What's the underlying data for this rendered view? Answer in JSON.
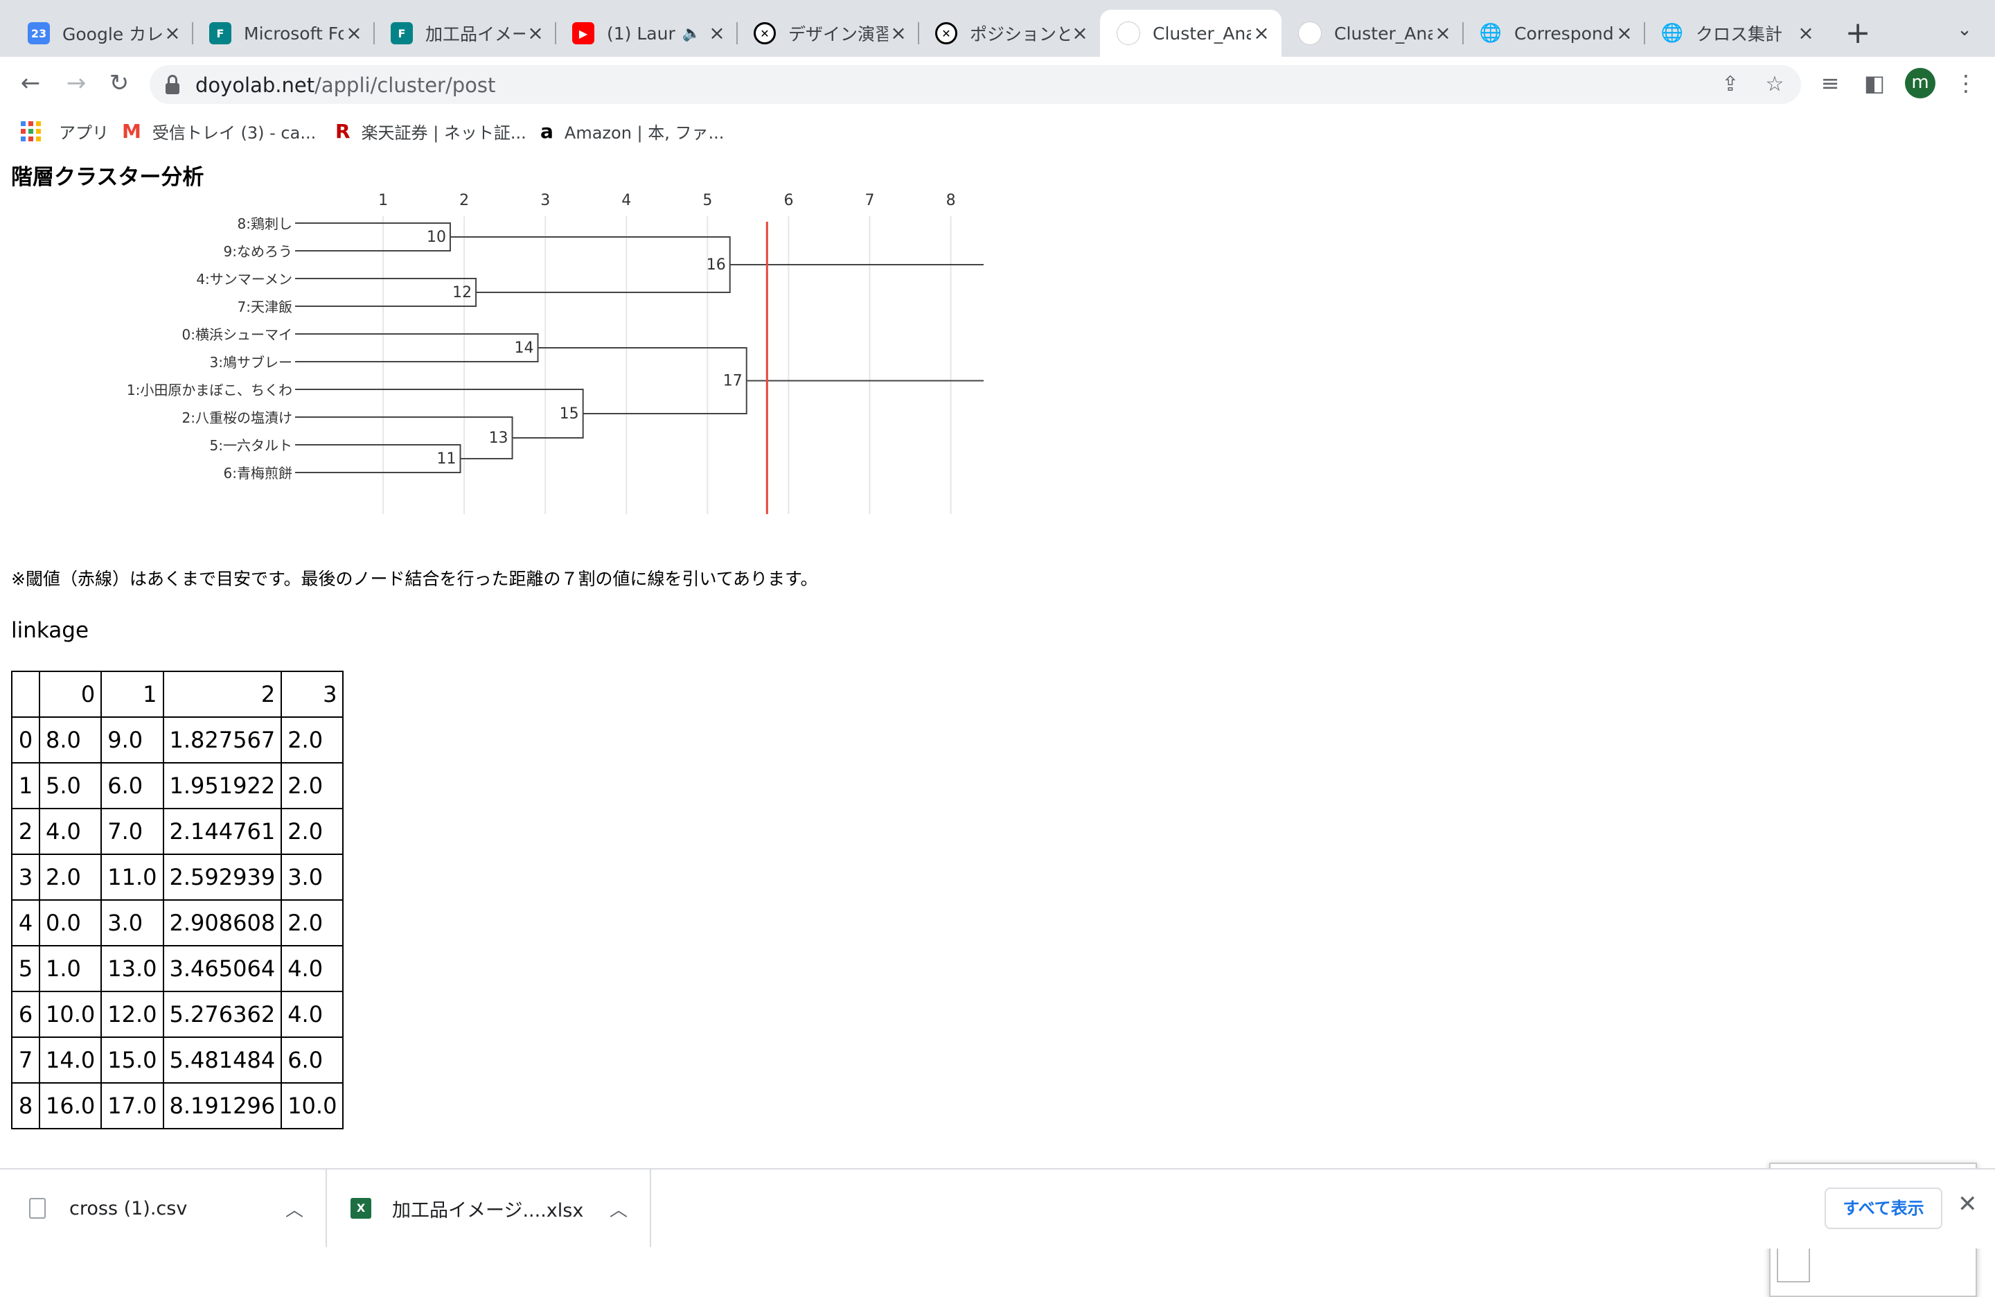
{
  "tabs": [
    {
      "title": "Google カレ",
      "icon": "calendar-icon",
      "icon_text": "23",
      "color": "#4285f4"
    },
    {
      "title": "Microsoft Fo",
      "icon": "forms-icon",
      "icon_text": "F",
      "color": "#038387"
    },
    {
      "title": "加工品イメー",
      "icon": "forms-icon",
      "icon_text": "F",
      "color": "#038387"
    },
    {
      "title": "(1) Laur",
      "icon": "youtube-icon",
      "icon_text": "▶",
      "color": "#ff0000",
      "audio": "🔈"
    },
    {
      "title": "デザイン演習",
      "icon": "x-logo-icon",
      "icon_text": "✕",
      "color": "#000000"
    },
    {
      "title": "ポジションと",
      "icon": "x-logo-icon",
      "icon_text": "✕",
      "color": "#000000"
    },
    {
      "title": "Cluster_Ana",
      "icon": "doyolab-icon",
      "icon_text": "",
      "color": "#bbbbbb",
      "active": true
    },
    {
      "title": "Cluster_Ana",
      "icon": "doyolab-icon",
      "icon_text": "",
      "color": "#bbbbbb"
    },
    {
      "title": "Correspond",
      "icon": "globe-icon",
      "icon_text": "🌐",
      "color": "#5f6368"
    },
    {
      "title": "クロス集計",
      "icon": "globe-icon",
      "icon_text": "🌐",
      "color": "#5f6368"
    }
  ],
  "address": {
    "domain": "doyolab.net",
    "path": "/appli/cluster/post"
  },
  "user_initial": "m",
  "bookmarks": [
    {
      "label": "アプリ",
      "icon": "apps-grid-icon"
    },
    {
      "label": "受信トレイ (3) - ca...",
      "icon": "gmail-icon",
      "icon_text": "M",
      "color": "#ea4335"
    },
    {
      "label": "楽天証券 | ネット証...",
      "icon": "rakuten-icon",
      "icon_text": "R",
      "color": "#bf0000"
    },
    {
      "label": "Amazon | 本, ファ...",
      "icon": "amazon-icon",
      "icon_text": "a",
      "color": "#000000"
    }
  ],
  "page": {
    "title": "階層クラスター分析",
    "note": "※閾値（赤線）はあくまで目安です。最後のノード結合を行った距離の７割の値に線を引いてあります。",
    "linkage_heading": "linkage"
  },
  "chart_data": {
    "type": "dendrogram",
    "orientation": "horizontal",
    "x_ticks": [
      "1",
      "2",
      "3",
      "4",
      "5",
      "6",
      "7",
      "8"
    ],
    "xlim": [
      0,
      8.2
    ],
    "threshold": 5.734,
    "threshold_color": "#e8463a",
    "line_color": "#444444",
    "leaves": [
      {
        "id": 8,
        "label": "8:鶏刺し"
      },
      {
        "id": 9,
        "label": "9:なめろう"
      },
      {
        "id": 4,
        "label": "4:サンマーメン"
      },
      {
        "id": 7,
        "label": "7:天津飯"
      },
      {
        "id": 0,
        "label": "0:横浜シューマイ"
      },
      {
        "id": 3,
        "label": "3:鳩サブレー"
      },
      {
        "id": 1,
        "label": "1:小田原かまぼこ、ちくわ"
      },
      {
        "id": 2,
        "label": "2:八重桜の塩漬け"
      },
      {
        "id": 5,
        "label": "5:一六タルト"
      },
      {
        "id": 6,
        "label": "6:青梅煎餅"
      }
    ],
    "merges": [
      {
        "id": 10,
        "left": 8,
        "right": 9,
        "distance": 1.827567,
        "label": "10"
      },
      {
        "id": 11,
        "left": 5,
        "right": 6,
        "distance": 1.951922,
        "label": "11"
      },
      {
        "id": 12,
        "left": 4,
        "right": 7,
        "distance": 2.144761,
        "label": "12"
      },
      {
        "id": 13,
        "left": 2,
        "right": 11,
        "distance": 2.592939,
        "label": "13"
      },
      {
        "id": 14,
        "left": 0,
        "right": 3,
        "distance": 2.908608,
        "label": "14"
      },
      {
        "id": 15,
        "left": 1,
        "right": 13,
        "distance": 3.465064,
        "label": "15"
      },
      {
        "id": 16,
        "left": 10,
        "right": 12,
        "distance": 5.276362,
        "label": "16"
      },
      {
        "id": 17,
        "left": 14,
        "right": 15,
        "distance": 5.481484,
        "label": "17"
      }
    ]
  },
  "linkage_table": {
    "columns": [
      "",
      "0",
      "1",
      "2",
      "3"
    ],
    "rows": [
      [
        "0",
        "8.0",
        "9.0",
        "1.827567",
        "2.0"
      ],
      [
        "1",
        "5.0",
        "6.0",
        "1.951922",
        "2.0"
      ],
      [
        "2",
        "4.0",
        "7.0",
        "2.144761",
        "2.0"
      ],
      [
        "3",
        "2.0",
        "11.0",
        "2.592939",
        "3.0"
      ],
      [
        "4",
        "0.0",
        "3.0",
        "2.908608",
        "2.0"
      ],
      [
        "5",
        "1.0",
        "13.0",
        "3.465064",
        "4.0"
      ],
      [
        "6",
        "10.0",
        "12.0",
        "5.276362",
        "4.0"
      ],
      [
        "7",
        "14.0",
        "15.0",
        "5.481484",
        "6.0"
      ],
      [
        "8",
        "16.0",
        "17.0",
        "8.191296",
        "10.0"
      ]
    ]
  },
  "downloads": [
    {
      "name": "cross (1).csv",
      "icon": "file-icon"
    },
    {
      "name": "加工品イメージ....xlsx",
      "icon": "excel-icon"
    }
  ],
  "download_bar": {
    "show_all": "すべて表示"
  }
}
